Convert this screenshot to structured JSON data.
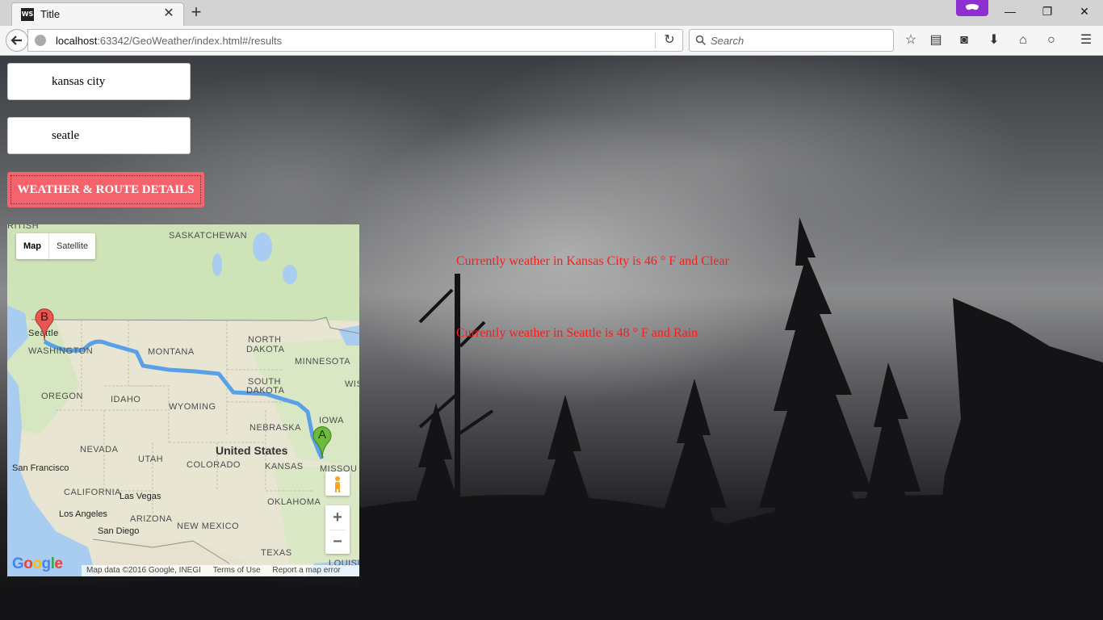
{
  "browser": {
    "tab_title": "Title",
    "tab_favicon": "WS",
    "url_host": "localhost",
    "url_rest": ":63342/GeoWeather/index.html#/results",
    "search_placeholder": "Search",
    "icons": [
      "back-arrow-icon",
      "globe-icon",
      "reload-icon",
      "search-icon",
      "star-icon",
      "reading-list-icon",
      "pocket-icon",
      "download-icon",
      "home-icon",
      "chat-icon",
      "menu-icon",
      "private-mask-icon"
    ]
  },
  "form": {
    "origin_value": "kansas city",
    "destination_value": "seatle",
    "details_button": "WEATHER & ROUTE DETAILS",
    "button_color": "#f5636d"
  },
  "map": {
    "type_map": "Map",
    "type_satellite": "Satellite",
    "zoom_in": "+",
    "zoom_out": "−",
    "marker_a": "A",
    "marker_b": "B",
    "labels": {
      "british": "RITISH",
      "saskatchewan": "SASKATCHEWAN",
      "seattle": "Seattle",
      "washington": "WASHINGTON",
      "montana": "MONTANA",
      "north_dakota_1": "NORTH",
      "north_dakota_2": "DAKOTA",
      "minnesota": "MINNESOTA",
      "oregon": "OREGON",
      "idaho": "IDAHO",
      "south_dakota_1": "SOUTH",
      "south_dakota_2": "DAKOTA",
      "wisconsin": "WIS",
      "wyoming": "WYOMING",
      "iowa": "IOWA",
      "nebraska": "NEBRASKA",
      "nevada": "NEVADA",
      "utah": "UTAH",
      "united_states": "United States",
      "colorado": "COLORADO",
      "kansas": "KANSAS",
      "missouri": "MISSOU",
      "san_francisco": "San Francisco",
      "california": "CALIFORNIA",
      "las_vegas": "Las Vegas",
      "los_angeles": "Los Angeles",
      "arizona": "ARIZONA",
      "oklahoma": "OKLAHOMA",
      "san_diego": "San Diego",
      "new_mexico": "NEW MEXICO",
      "texas": "TEXAS",
      "louisiana": "LOUISI"
    },
    "footer_data": "Map data ©2016 Google, INEGI",
    "footer_terms": "Terms of Use",
    "footer_report": "Report a map error",
    "logo": "Google",
    "route_color": "#4a90e2"
  },
  "weather": {
    "origin_text": "Currently weather in Kansas City is 46 ° F and Clear",
    "destination_text": "Currently weather in Seattle is 48 ° F and Rain",
    "text_color": "#ff1a1a"
  }
}
